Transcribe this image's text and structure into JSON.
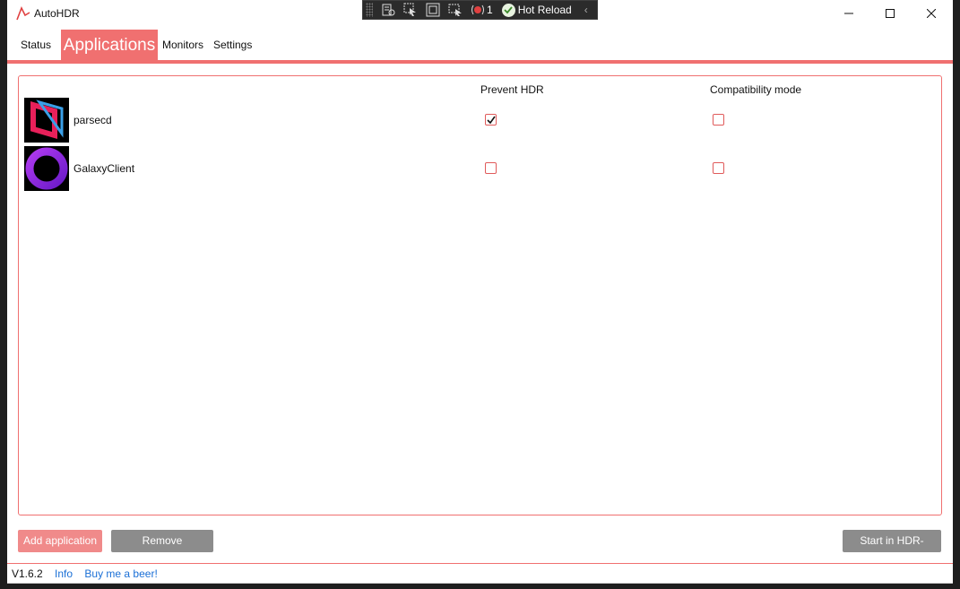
{
  "window": {
    "title": "AutoHDR",
    "minimize_icon": "minimize-icon",
    "maximize_icon": "maximize-icon",
    "close_icon": "close-icon"
  },
  "hot_reload_toolbar": {
    "error_count": "1",
    "label": "Hot Reload"
  },
  "tabs": [
    {
      "label": "Status",
      "active": false
    },
    {
      "label": "Applications",
      "active": true
    },
    {
      "label": "Monitors",
      "active": false
    },
    {
      "label": "Settings",
      "active": false
    }
  ],
  "applications": {
    "columns": [
      "Prevent HDR",
      "Compatibility mode"
    ],
    "rows": [
      {
        "name": "parsecd",
        "prevent_hdr": true,
        "compatibility_mode": false
      },
      {
        "name": "GalaxyClient",
        "prevent_hdr": false,
        "compatibility_mode": false
      }
    ]
  },
  "buttons": {
    "add": "Add application",
    "remove": "Remove application",
    "start": "Start in HDR-Mode"
  },
  "footer": {
    "version": "V1.6.2",
    "info": "Info",
    "beer": "Buy me a beer!"
  },
  "colors": {
    "accent": "#f07070",
    "button_gray": "#8c8c8c",
    "link": "#1a6fd6"
  }
}
